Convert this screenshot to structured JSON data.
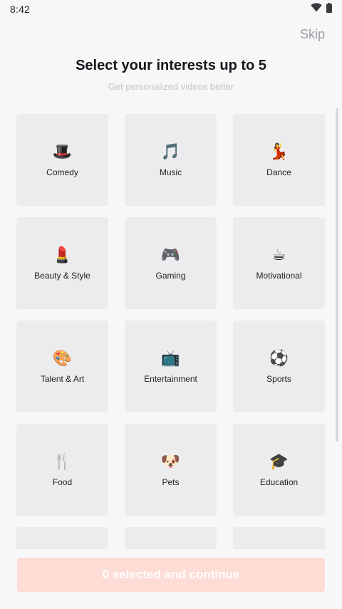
{
  "status_bar": {
    "time": "8:42",
    "icons": [
      "wifi-icon",
      "battery-icon"
    ]
  },
  "header": {
    "skip_label": "Skip",
    "title": "Select your interests up to 5",
    "subtitle": "Get personalized videos better"
  },
  "interests": [
    {
      "label": "Comedy",
      "emoji": "🎩",
      "icon": "top-hat-icon"
    },
    {
      "label": "Music",
      "emoji": "🎵",
      "icon": "music-note-icon"
    },
    {
      "label": "Dance",
      "emoji": "💃",
      "icon": "dancer-icon"
    },
    {
      "label": "Beauty & Style",
      "emoji": "💄",
      "icon": "lipstick-icon"
    },
    {
      "label": "Gaming",
      "emoji": "🎮",
      "icon": "game-controller-icon"
    },
    {
      "label": "Motivational",
      "emoji": "☕",
      "icon": "coffee-icon"
    },
    {
      "label": "Talent & Art",
      "emoji": "🎨",
      "icon": "palette-icon"
    },
    {
      "label": "Entertainment",
      "emoji": "📺",
      "icon": "television-icon"
    },
    {
      "label": "Sports",
      "emoji": "⚽",
      "icon": "soccer-ball-icon"
    },
    {
      "label": "Food",
      "emoji": "🍴",
      "icon": "fork-knife-icon"
    },
    {
      "label": "Pets",
      "emoji": "🐶",
      "icon": "dog-icon"
    },
    {
      "label": "Education",
      "emoji": "🎓",
      "icon": "graduation-cap-icon"
    },
    {
      "label": "",
      "emoji": "",
      "icon": ""
    },
    {
      "label": "",
      "emoji": "",
      "icon": ""
    },
    {
      "label": "",
      "emoji": "",
      "icon": ""
    }
  ],
  "footer": {
    "continue_label": "0 selected and continue"
  },
  "colors": {
    "background": "#f7f7f9",
    "card": "#ececee",
    "button_disabled": "#fcdcd4",
    "skip_text": "#9a9aa0",
    "subtitle_text": "#c4c4c8"
  }
}
